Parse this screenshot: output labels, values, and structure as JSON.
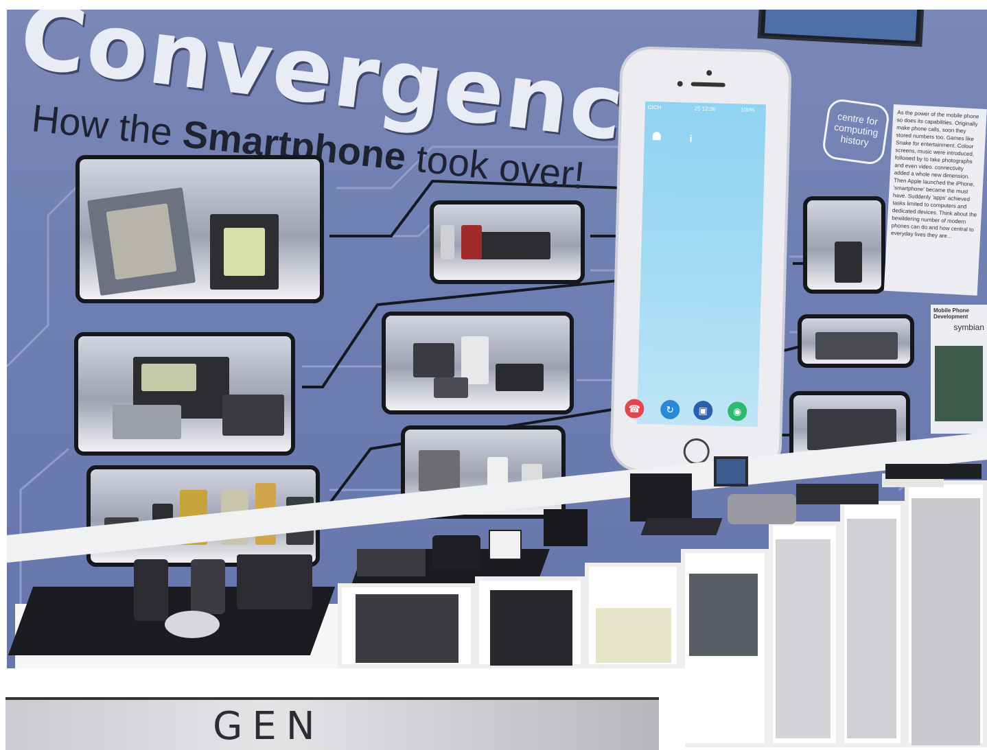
{
  "exhibit": {
    "title": "Convergence",
    "subtitle_prefix": "How the ",
    "subtitle_bold": "Smartphone",
    "subtitle_suffix": " took over!",
    "logo_text": "centre for computing history",
    "info_panel_text": "As the power of the mobile phone so does its capabilities. Originally make phone calls, soon they stored numbers too. Games like Snake for entertainment. Colour screens, music were introduced, followed by to take photographs and even video. connectivity added a whole new dimension. Then Apple launched the iPhone, 'smartphone' became the must have. Suddenly 'apps' achieved tasks limited to computers and dedicated devices. Think about the bewildering number of modern phones can do and how central to everyday lives they are...",
    "info_panel2_title": "Mobile Phone Development",
    "info_panel2_brand": "symbian"
  },
  "phone": {
    "carrier": "CICH",
    "time": "25 12:36",
    "battery": "100%"
  },
  "photo2": {
    "sign_text": "GEN"
  },
  "colors": {
    "wall": "#6f7fb2",
    "circuit": "#95a3cf",
    "title": "#e9ecf4",
    "phone_screen": "#a7dcf3"
  }
}
